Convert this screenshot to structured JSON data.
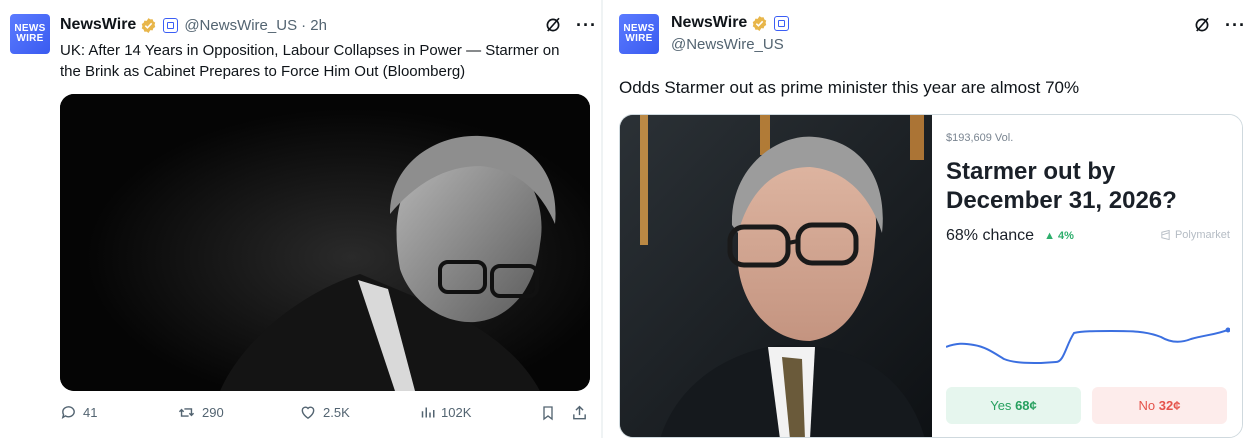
{
  "left_tweet": {
    "avatar": {
      "line1": "NEWS",
      "line2": "WIRE"
    },
    "name": "NewsWire",
    "handle": "@NewsWire_US",
    "time": "· 2h",
    "text_line1": "UK: After 14 Years in Opposition, Labour Collapses in Power — Starmer on",
    "text_line2": "the Brink as Cabinet Prepares to Force Him Out (Bloomberg)",
    "more_label": "···",
    "actions": {
      "replies": "41",
      "reposts": "290",
      "likes": "2.5K",
      "views": "102K"
    }
  },
  "right_tweet": {
    "avatar": {
      "line1": "NEWS",
      "line2": "WIRE"
    },
    "name": "NewsWire",
    "handle": "@NewsWire_US",
    "more_label": "···",
    "text": "Odds Starmer out as prime minister this year are almost 70%",
    "market": {
      "volume": "$193,609 Vol.",
      "question_line1": "Starmer out by",
      "question_line2": "December 31, 2026?",
      "chance": "68% chance",
      "delta": "▲ 4%",
      "source": "Polymarket",
      "yes_label": "Yes ",
      "yes_price": "68¢",
      "no_label": "No ",
      "no_price": "32¢",
      "line_color": "#3b6fe0"
    }
  },
  "colors": {
    "brand_blue": "#3b5ef5",
    "verified_gold": "#e8b64a",
    "muted": "#536471"
  }
}
